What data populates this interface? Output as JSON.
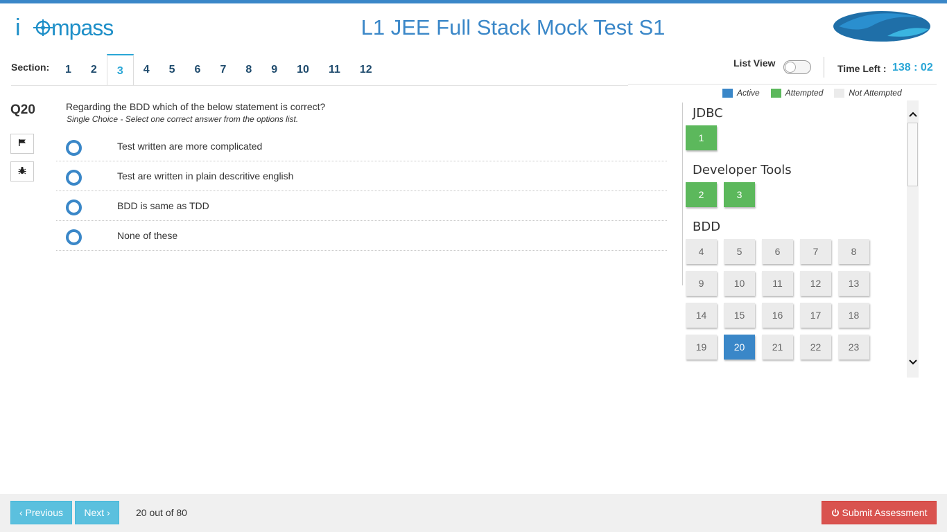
{
  "header": {
    "logo_text": "icompass",
    "title": "L1 JEE Full Stack Mock Test S1"
  },
  "section_bar": {
    "label": "Section:",
    "tabs": [
      "1",
      "2",
      "3",
      "4",
      "5",
      "6",
      "7",
      "8",
      "9",
      "10",
      "11",
      "12"
    ],
    "active_tab": "3",
    "list_view_label": "List View",
    "list_view_on": false,
    "time_left_label": "Time Left :",
    "time_left_value": "138 : 02"
  },
  "legend": [
    {
      "label": "Active",
      "color": "#3a87c8"
    },
    {
      "label": "Attempted",
      "color": "#5cb85c"
    },
    {
      "label": "Not Attempted",
      "color": "#ebebeb"
    }
  ],
  "question": {
    "number": "Q20",
    "text": "Regarding the BDD which of the below statement is correct?",
    "instruction": "Single Choice - Select one correct answer from the options list.",
    "options": [
      "Test written are more complicated",
      "Test are written in plain descritive english",
      "BDD is same as TDD",
      "None of these"
    ],
    "side_icons": [
      "flag-icon",
      "bug-icon"
    ]
  },
  "palette": {
    "groups": [
      {
        "title": "JDBC",
        "items": [
          {
            "n": "1",
            "state": "att"
          }
        ]
      },
      {
        "title": "Developer Tools",
        "items": [
          {
            "n": "2",
            "state": "att"
          },
          {
            "n": "3",
            "state": "att"
          }
        ]
      },
      {
        "title": "BDD",
        "items": [
          {
            "n": "4",
            "state": "na"
          },
          {
            "n": "5",
            "state": "na"
          },
          {
            "n": "6",
            "state": "na"
          },
          {
            "n": "7",
            "state": "na"
          },
          {
            "n": "8",
            "state": "na"
          },
          {
            "n": "9",
            "state": "na"
          },
          {
            "n": "10",
            "state": "na"
          },
          {
            "n": "11",
            "state": "na"
          },
          {
            "n": "12",
            "state": "na"
          },
          {
            "n": "13",
            "state": "na"
          },
          {
            "n": "14",
            "state": "na"
          },
          {
            "n": "15",
            "state": "na"
          },
          {
            "n": "16",
            "state": "na"
          },
          {
            "n": "17",
            "state": "na"
          },
          {
            "n": "18",
            "state": "na"
          },
          {
            "n": "19",
            "state": "na"
          },
          {
            "n": "20",
            "state": "act"
          },
          {
            "n": "21",
            "state": "na"
          },
          {
            "n": "22",
            "state": "na"
          },
          {
            "n": "23",
            "state": "na"
          }
        ]
      }
    ]
  },
  "footer": {
    "previous_label": "‹ Previous",
    "next_label": "Next ›",
    "progress": "20 out of 80",
    "submit_label": "Submit Assessment",
    "submit_icon": "power-icon"
  }
}
